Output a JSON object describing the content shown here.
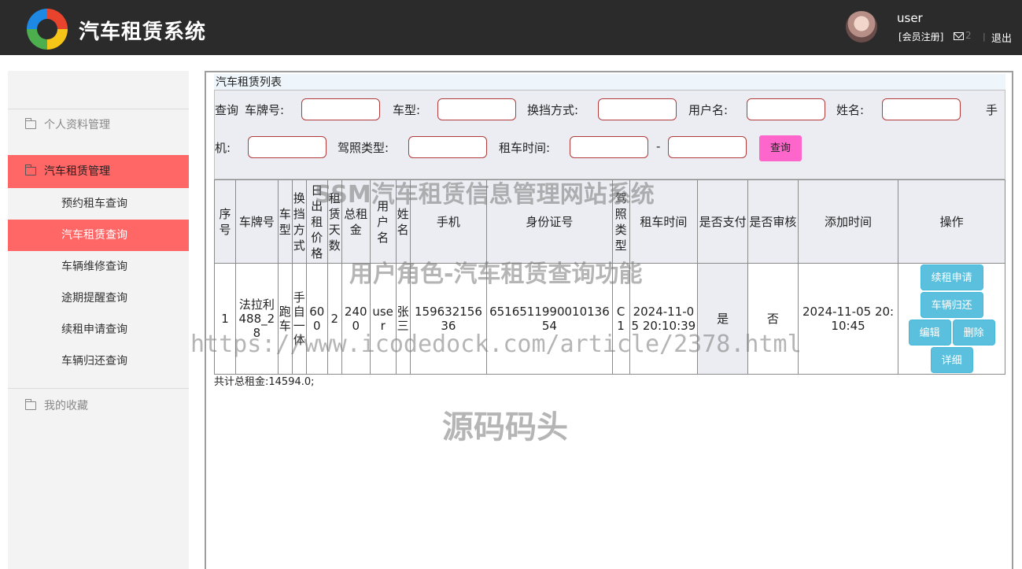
{
  "header": {
    "app_title": "汽车租赁系统",
    "username": "user",
    "member_register": "[会员注册]",
    "mail_count": "2",
    "separator": "|",
    "logout": "退出"
  },
  "sidebar": {
    "groups": [
      {
        "label": "个人资料管理"
      },
      {
        "label": "汽车租赁管理"
      },
      {
        "label": "我的收藏"
      }
    ],
    "items": [
      {
        "label": "预约租车查询"
      },
      {
        "label": "汽车租赁查询"
      },
      {
        "label": "车辆维修查询"
      },
      {
        "label": "途期提醒查询"
      },
      {
        "label": "续租申请查询"
      },
      {
        "label": "车辆归还查询"
      }
    ]
  },
  "panel": {
    "title": "汽车租赁列表",
    "search": {
      "query_label": "查询",
      "plate_label": "车牌号:",
      "type_label": "车型:",
      "gear_label": "换挡方式:",
      "user_label": "用户名:",
      "name_label": "姓名:",
      "phone_label_1": "手",
      "phone_label_2": "机:",
      "license_label": "驾照类型:",
      "time_label": "租车时间:",
      "dash": "-",
      "button": "查询"
    },
    "table": {
      "headers": [
        "序号",
        "车牌号",
        "车型",
        "换挡方式",
        "日出租价格",
        "租赁天数",
        "总租金",
        "用户名",
        "姓名",
        "手机",
        "身份证号",
        "驾照类型",
        "租车时间",
        "是否支付",
        "是否审核",
        "添加时间",
        "操作"
      ],
      "rows": [
        {
          "index": "1",
          "plate": "法拉利488_28",
          "type": "跑车",
          "gear": "手自一体",
          "daily_price": "600",
          "days": "2",
          "total": "2400",
          "username": "user",
          "name": "张三",
          "phone": "15963215636",
          "id_card": "651651199001013654",
          "license": "C1",
          "rent_time": "2024-11-05 20:10:39",
          "paid": "是",
          "reviewed": "否",
          "added_time": "2024-11-05 20:10:45"
        }
      ],
      "actions": {
        "renew": "续租申请",
        "return": "车辆归还",
        "edit": "编辑",
        "delete": "删除",
        "detail": "详细"
      }
    },
    "total_text": "共计总租金:14594.0;"
  },
  "watermarks": {
    "title": "SSM汽车租赁信息管理网站系统",
    "subtitle": "用户角色-汽车租赁查询功能",
    "url": "https://www.icodedock.com/article/2378.html",
    "brand": "源码码头"
  }
}
